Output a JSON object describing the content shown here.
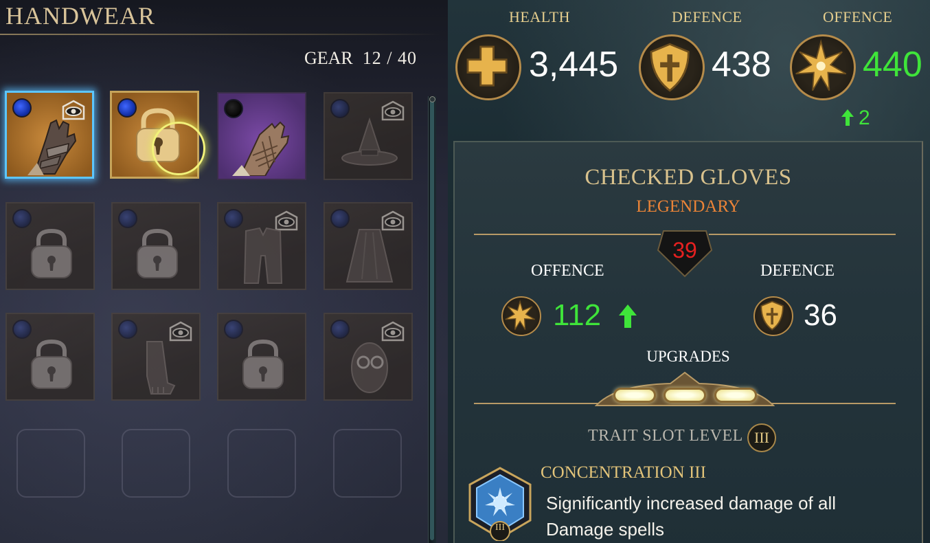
{
  "left": {
    "title": "HANDWEAR",
    "gear_label": "GEAR",
    "gear_count": "12 / 40"
  },
  "stats": {
    "health": {
      "label": "HEALTH",
      "value": "3,445"
    },
    "defence": {
      "label": "DEFENCE",
      "value": "438"
    },
    "offence": {
      "label": "OFFENCE",
      "value": "440",
      "delta": "2"
    }
  },
  "item": {
    "name": "CHECKED GLOVES",
    "rarity": "LEGENDARY",
    "level": "39",
    "offence_label": "OFFENCE",
    "offence_value": "112",
    "defence_label": "DEFENCE",
    "defence_value": "36",
    "upgrades_label": "UPGRADES",
    "upgrades_filled": 3,
    "upgrades_total": 3,
    "trait_slot_label": "TRAIT SLOT LEVEL",
    "trait_slot_level": "III",
    "trait_name": "CONCENTRATION III",
    "trait_description": "Significantly increased damage of all Damage spells",
    "trait_badge": "III"
  },
  "colors": {
    "accent_gold": "#d9c28d",
    "rarity_legendary": "#ec8437",
    "stat_gain_green": "#3fe43a",
    "selection_blue": "#5cc6ff"
  },
  "inventory": [
    {
      "kind": "gloves-orange",
      "icon": "leather-gauntlet-icon",
      "gem": "blue",
      "eye": true,
      "state": "selected"
    },
    {
      "kind": "locked-gold",
      "icon": "padlock-icon",
      "gem": "blue",
      "eye": false,
      "state": "unlocking"
    },
    {
      "kind": "gloves-purple",
      "icon": "checked-glove-icon",
      "gem": "black",
      "eye": false,
      "state": "normal"
    },
    {
      "kind": "faded",
      "icon": "witch-hat-icon",
      "gem": "dim",
      "eye": true,
      "state": "unowned"
    },
    {
      "kind": "faded",
      "icon": "padlock-icon",
      "gem": "dim",
      "eye": false,
      "state": "locked"
    },
    {
      "kind": "faded",
      "icon": "padlock-icon",
      "gem": "dim",
      "eye": false,
      "state": "locked"
    },
    {
      "kind": "faded",
      "icon": "tunic-icon",
      "gem": "dim",
      "eye": true,
      "state": "unowned"
    },
    {
      "kind": "faded",
      "icon": "cloak-icon",
      "gem": "dim",
      "eye": true,
      "state": "unowned"
    },
    {
      "kind": "faded",
      "icon": "padlock-icon",
      "gem": "dim",
      "eye": false,
      "state": "locked"
    },
    {
      "kind": "faded",
      "icon": "scarf-icon",
      "gem": "dim",
      "eye": true,
      "state": "unowned"
    },
    {
      "kind": "faded",
      "icon": "padlock-icon",
      "gem": "dim",
      "eye": false,
      "state": "locked"
    },
    {
      "kind": "faded",
      "icon": "glasses-mask-icon",
      "gem": "dim",
      "eye": true,
      "state": "unowned"
    },
    {
      "kind": "empty",
      "icon": "",
      "gem": "",
      "eye": false,
      "state": "empty"
    },
    {
      "kind": "empty",
      "icon": "",
      "gem": "",
      "eye": false,
      "state": "empty"
    },
    {
      "kind": "empty",
      "icon": "",
      "gem": "",
      "eye": false,
      "state": "empty"
    },
    {
      "kind": "empty",
      "icon": "",
      "gem": "",
      "eye": false,
      "state": "empty"
    }
  ]
}
